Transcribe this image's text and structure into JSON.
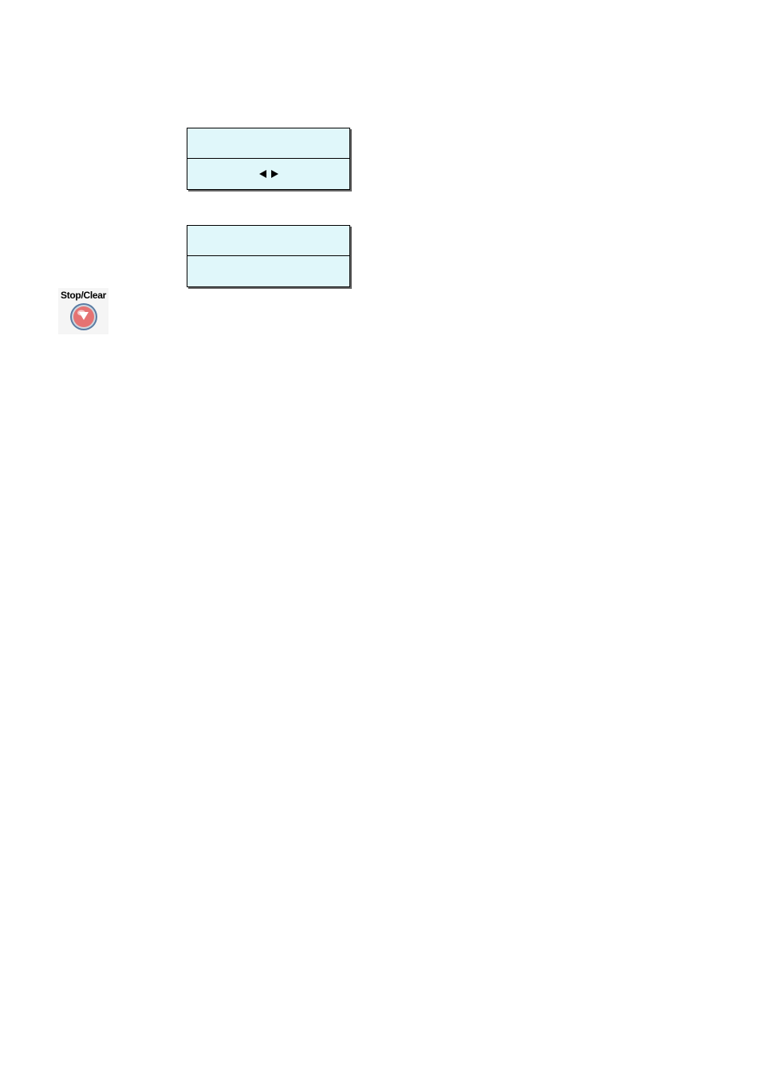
{
  "stopClear": {
    "label": "Stop/Clear"
  },
  "colors": {
    "panelFill": "#e0f7fa",
    "buttonFill": "#e57373",
    "buttonRing": "#5a7ca3",
    "buttonHighlight": "#ffffff"
  }
}
